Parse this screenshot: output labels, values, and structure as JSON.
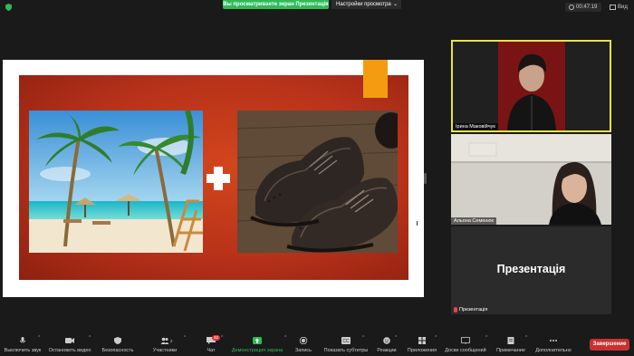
{
  "topbar": {
    "sharing_notice": "Вы просматриваете экран Презентація",
    "view_options": "Настройки просмотра",
    "timer": "00:47:19",
    "view": "Вид"
  },
  "participants": [
    {
      "name": "Ірина Маковійчук"
    },
    {
      "name": "Альона Семенюк"
    },
    {
      "name": "Презентація",
      "big_label": "Презентація"
    }
  ],
  "toolbar": {
    "items": [
      {
        "label": "Выключить звук",
        "icon": "microphone-icon"
      },
      {
        "label": "Остановить видео",
        "icon": "video-camera-icon"
      },
      {
        "label": "Безопасность",
        "icon": "shield-icon"
      },
      {
        "label": "Участники",
        "icon": "participants-icon",
        "count": "2"
      },
      {
        "label": "Чат",
        "icon": "chat-icon",
        "badge": "32"
      },
      {
        "label": "Демонстрация экрана",
        "icon": "share-screen-icon"
      },
      {
        "label": "Запись",
        "icon": "record-icon"
      },
      {
        "label": "Показать субтитры",
        "icon": "captions-icon"
      },
      {
        "label": "Реакции",
        "icon": "reactions-icon"
      },
      {
        "label": "Приложения",
        "icon": "apps-icon"
      },
      {
        "label": "Доски сообщений",
        "icon": "whiteboard-icon"
      },
      {
        "label": "Примечание",
        "icon": "notes-icon"
      },
      {
        "label": "Дополнительно",
        "icon": "more-icon"
      }
    ],
    "end_label": "Завершение"
  },
  "colors": {
    "share_green": "#2dbb55",
    "active_speaker": "#e8e24a",
    "end_red": "#c8312f",
    "slide_red": "#c0391b",
    "slide_orange": "#f39c12"
  }
}
